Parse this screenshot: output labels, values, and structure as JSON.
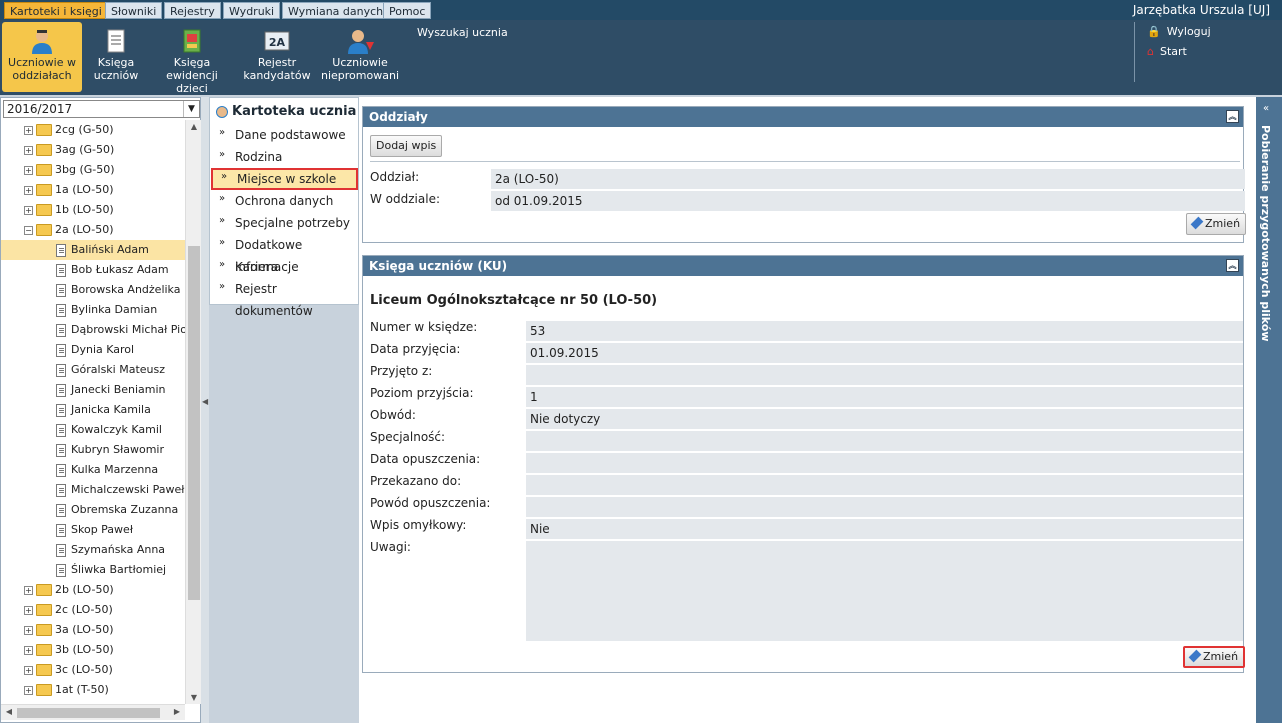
{
  "menu": [
    "Kartoteki i księgi",
    "Słowniki",
    "Rejestry",
    "Wydruki",
    "Wymiana danych",
    "Pomoc"
  ],
  "user": "Jarzębatka Urszula [UJ]",
  "toolbar": {
    "b1a": "Uczniowie w",
    "b1b": "oddziałach",
    "b2a": "Księga",
    "b2b": "uczniów",
    "b3a": "Księga",
    "b3b": "ewidencji dzieci",
    "b4a": "Rejestr",
    "b4b": "kandydatów",
    "b5a": "Uczniowie",
    "b5b": "niepromowani",
    "search": "Wyszukaj ucznia",
    "logout": "Wyloguj",
    "start": "Start"
  },
  "year": "2016/2017",
  "tree": [
    "2cg (G-50)",
    "3ag (G-50)",
    "3bg (G-50)",
    "1a (LO-50)",
    "1b (LO-50)",
    "2a (LO-50)",
    "Baliński Adam",
    "Bob Łukasz Adam",
    "Borowska Andżelika Ew",
    "Bylinka Damian",
    "Dąbrowski Michał Piotr",
    "Dynia Karol",
    "Góralski Mateusz",
    "Janecki Beniamin",
    "Janicka Kamila",
    "Kowalczyk Kamil",
    "Kubryn Sławomir",
    "Kulka Marzenna",
    "Michalczewski Paweł",
    "Obremska Zuzanna",
    "Skop Paweł",
    "Szymańska Anna",
    "Śliwka Bartłomiej",
    "2b (LO-50)",
    "2c (LO-50)",
    "3a (LO-50)",
    "3b (LO-50)",
    "3c (LO-50)",
    "1at (T-50)"
  ],
  "nav": {
    "title": "Kartoteka ucznia",
    "items": [
      "Dane podstawowe",
      "Rodzina",
      "Miejsce w szkole",
      "Ochrona danych",
      "Specjalne potrzeby",
      "Dodatkowe informacje",
      "Kariera",
      "Rejestr dokumentów"
    ]
  },
  "oddzialy": {
    "title": "Oddziały",
    "add": "Dodaj wpis",
    "l1": "Oddział:",
    "v1": "2a (LO-50)",
    "l2": "W oddziale:",
    "v2": "od 01.09.2015",
    "change": "Zmień"
  },
  "ksiega": {
    "title": "Księga uczniów (KU)",
    "school": "Liceum Ogólnokształcące nr 50 (LO-50)",
    "labels": [
      "Numer w księdze:",
      "Data przyjęcia:",
      "Przyjęto z:",
      "Poziom przyjścia:",
      "Obwód:",
      "Specjalność:",
      "Data opuszczenia:",
      "Przekazano do:",
      "Powód opuszczenia:",
      "Wpis omyłkowy:",
      "Uwagi:"
    ],
    "values": [
      "53",
      "01.09.2015",
      "",
      "1",
      "Nie dotyczy",
      "",
      "",
      "",
      "",
      "Nie",
      ""
    ],
    "change": "Zmień"
  },
  "rightbar": "Pobieranie przygotowanych plików"
}
